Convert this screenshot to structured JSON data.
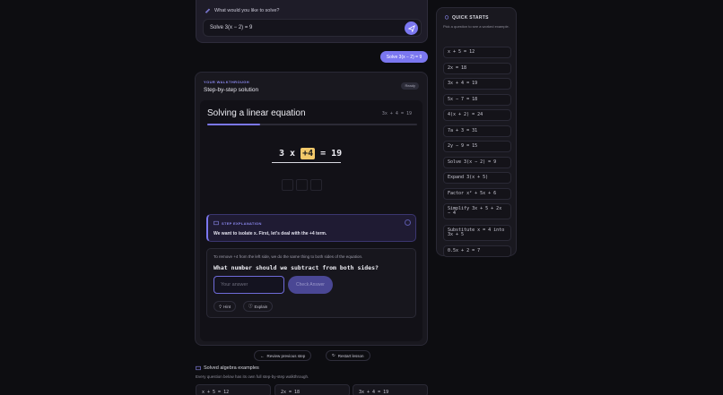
{
  "query": {
    "heading": "What would you like to solve?",
    "value": "Solve 3(x − 2) = 9"
  },
  "user_bubble": "Solve 3(x − 2) = 9",
  "walkthrough": {
    "kicker": "YOUR WALKTHROUGH",
    "title": "Step-by-step solution",
    "badge": "Ready",
    "lesson_title": "Solving a linear equation",
    "lesson_equation": "3x + 4 = 19",
    "progress_fraction": 0.25,
    "equation": {
      "coef": "3",
      "var": "x",
      "term": "+4",
      "eq": "=",
      "rhs": "19"
    },
    "step_label": "STEP EXPLANATION",
    "step_text": "We want to isolate x. First, let's deal with the +4 term.",
    "question_intro": "To remove +4 from the left side, we do the same thing to both sides of the equation.",
    "question": "What number should we subtract from both sides?",
    "answer_placeholder": "Your answer",
    "check_label": "Check Answer",
    "hint_label": "Hint",
    "explain_label": "Explain",
    "review_label": "Review previous step",
    "restart_label": "Restart lesson"
  },
  "quick_starts": {
    "title": "QUICK STARTS",
    "subtitle": "Pick a question to see a worked example.",
    "items": [
      "x + 5 = 12",
      "2x = 18",
      "3x + 4 = 19",
      "5x − 7 = 18",
      "4(x + 2) = 24",
      "7a + 3 = 31",
      "2y − 9 = 15",
      "Solve 3(x − 2) = 9",
      "Expand 3(x + 5)",
      "Factor x² + 5x + 6",
      "Simplify 3x + 5 + 2x − 4",
      "Substitute x = 4 into 3x + 5",
      "0.5x + 2 = 7"
    ]
  },
  "solved": {
    "title": "Solved algebra examples",
    "subtitle": "Every question below has its own full step-by-step walkthrough.",
    "examples": [
      "x + 5 = 12",
      "2x = 18",
      "3x + 4 = 19"
    ]
  },
  "colors": {
    "accent": "#7b77f0",
    "highlight": "#f3c96a",
    "background": "#0d0d11"
  }
}
